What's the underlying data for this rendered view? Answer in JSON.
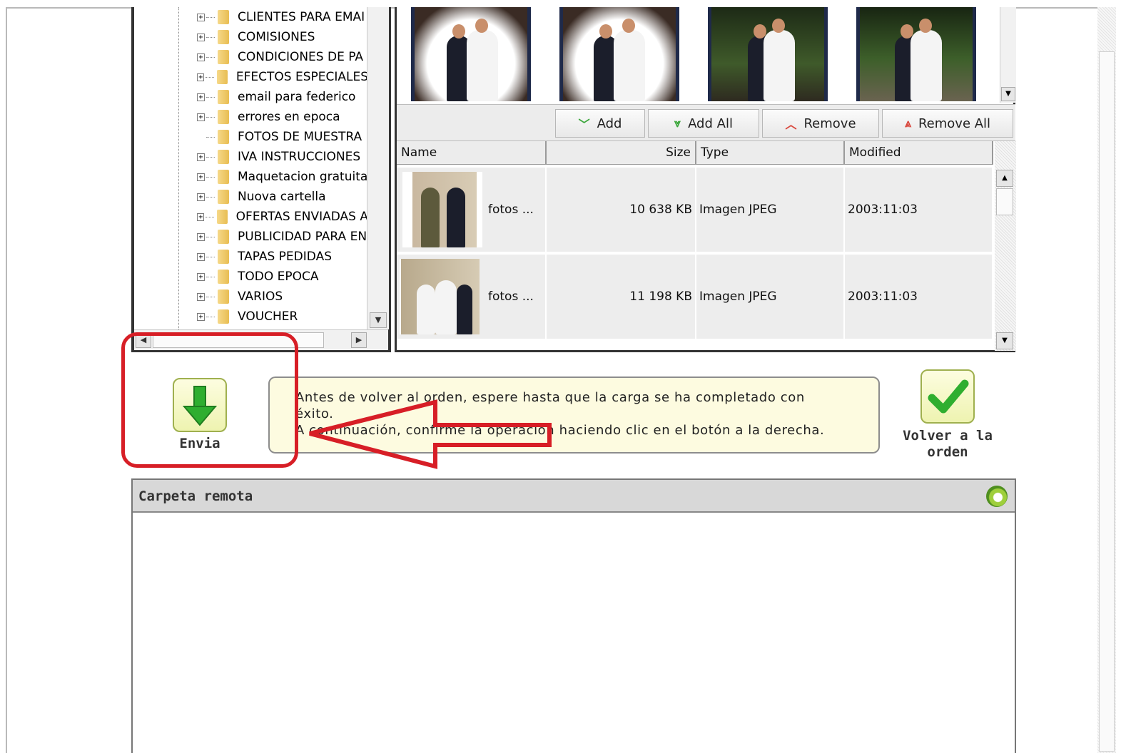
{
  "folder_tree": {
    "items": [
      {
        "label": "CLIENTES PARA EMAI",
        "expander": "+"
      },
      {
        "label": "COMISIONES",
        "expander": "+"
      },
      {
        "label": "CONDICIONES DE PA",
        "expander": "+"
      },
      {
        "label": "EFECTOS ESPECIALES",
        "expander": "+"
      },
      {
        "label": "email para federico",
        "expander": "+"
      },
      {
        "label": "errores en epoca",
        "expander": "+"
      },
      {
        "label": "FOTOS DE MUESTRA",
        "expander": ""
      },
      {
        "label": "IVA INSTRUCCIONES",
        "expander": "+"
      },
      {
        "label": "Maquetacion gratuita",
        "expander": "+"
      },
      {
        "label": "Nuova cartella",
        "expander": "+"
      },
      {
        "label": "OFERTAS ENVIADAS A",
        "expander": "+"
      },
      {
        "label": "PUBLICIDAD PARA EN",
        "expander": "+"
      },
      {
        "label": "TAPAS PEDIDAS",
        "expander": "+"
      },
      {
        "label": "TODO EPOCA",
        "expander": "+"
      },
      {
        "label": "VARIOS",
        "expander": "+"
      },
      {
        "label": "VOUCHER",
        "expander": "+"
      }
    ]
  },
  "toolbar": {
    "add_label": "Add",
    "add_all_label": "Add All",
    "remove_label": "Remove",
    "remove_all_label": "Remove All"
  },
  "file_grid": {
    "columns": {
      "name": "Name",
      "size": "Size",
      "type": "Type",
      "modified": "Modified"
    },
    "rows": [
      {
        "name": "fotos ...",
        "size": "10 638 KB",
        "type": "Imagen JPEG",
        "modified": "2003:11:03"
      },
      {
        "name": "fotos ...",
        "size": "11 198 KB",
        "type": "Imagen JPEG",
        "modified": "2003:11:03"
      }
    ]
  },
  "send_button": {
    "label": "Envia"
  },
  "info_message": {
    "line1": "Antes de volver al orden, espere hasta que la carga se ha completado con",
    "line2": "éxito.",
    "line3": "A continuación, confirme la operación haciendo clic en el botón a la derecha."
  },
  "return_button": {
    "line1": "Volver a la",
    "line2": "orden"
  },
  "remote_folder": {
    "title": "Carpeta remota"
  },
  "colors": {
    "highlight_red": "#d71e26",
    "button_green": "#3aa63a",
    "info_bg": "#fdfbe0"
  }
}
